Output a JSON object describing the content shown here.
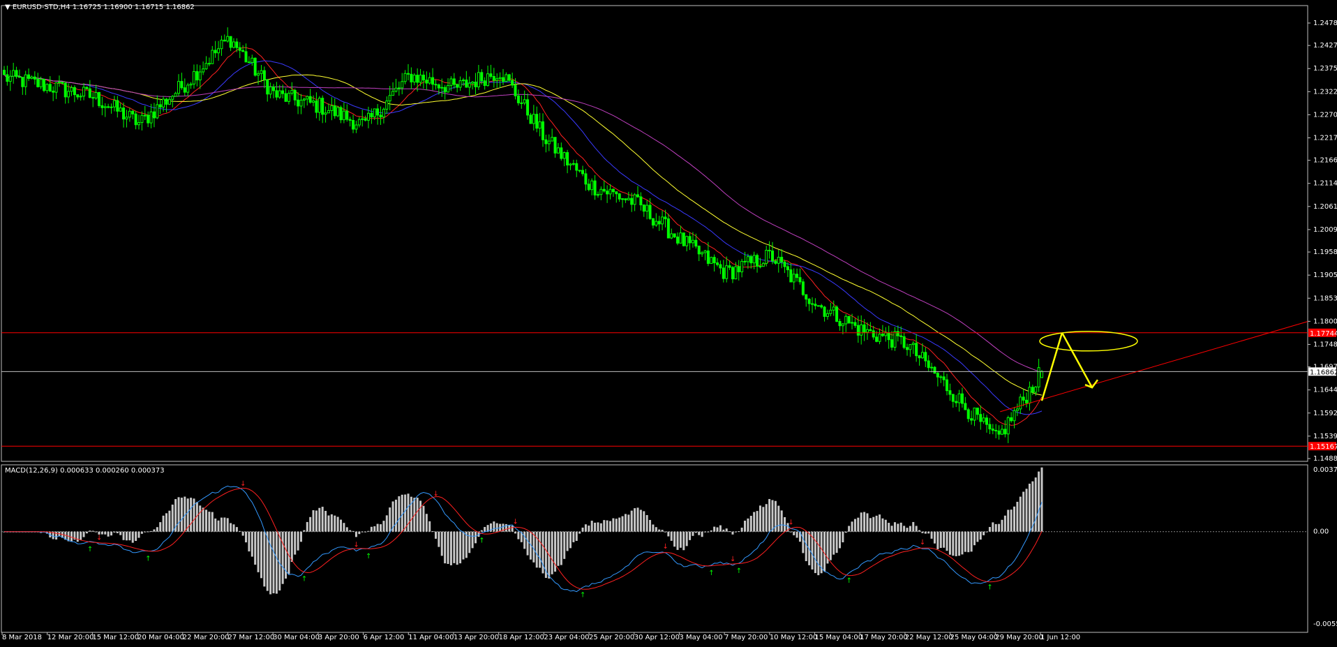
{
  "symbol_info": "EURUSD-STD,H4  1.16725 1.16900 1.16715 1.16862",
  "macd_info": "MACD(12,26,9) 0.000633 0.000260 0.000373",
  "colors": {
    "background": "#000000",
    "frame": "#c0c0c0",
    "candle": "#00ff00",
    "ma_fast": "#ff2020",
    "ma_mid": "#3a3aff",
    "ma_slow": "#ffff30",
    "ma_slowest": "#c040c0",
    "level_line": "#ff0000",
    "price_line": "#c0c0c0",
    "annotation": "#ffff00",
    "histogram": "#c8c8c8",
    "macd_line": "#3399ff",
    "signal_line": "#ff2020",
    "arrow_up": "#00ff00",
    "arrow_down": "#ff2020"
  },
  "price_axis": {
    "labels": [
      "1.24785",
      "1.24275",
      "1.23750",
      "1.23225",
      "1.22700",
      "1.22175",
      "1.21665",
      "1.21140",
      "1.20615",
      "1.20090",
      "1.19580",
      "1.19055",
      "1.18530",
      "1.18005",
      "1.17480",
      "1.16970",
      "1.16445",
      "1.15920",
      "1.15395",
      "1.14885"
    ],
    "resistance_label": "1.17744",
    "current_label": "1.16862",
    "support_label": "1.15167"
  },
  "macd_axis": {
    "top": "0.003788",
    "zero": "0.00",
    "bottom": "-0.005549"
  },
  "time_axis": [
    "8 Mar 2018",
    "12 Mar 20:00",
    "15 Mar 12:00",
    "20 Mar 04:00",
    "22 Mar 20:00",
    "27 Mar 12:00",
    "30 Mar 04:00",
    "3 Apr 20:00",
    "6 Apr 12:00",
    "11 Apr 04:00",
    "13 Apr 20:00",
    "18 Apr 12:00",
    "23 Apr 04:00",
    "25 Apr 20:00",
    "30 Apr 12:00",
    "3 May 04:00",
    "7 May 20:00",
    "10 May 12:00",
    "15 May 04:00",
    "17 May 20:00",
    "22 May 12:00",
    "25 May 04:00",
    "29 May 20:00",
    "1 Jun 12:00"
  ],
  "chart_data": {
    "type": "candlestick",
    "title": "EURUSD-STD,H4",
    "timeframe": "H4",
    "last_bar": {
      "open": 1.16725,
      "high": 1.169,
      "low": 1.16715,
      "close": 1.16862
    },
    "ylim": [
      1.14885,
      1.24785
    ],
    "key_close_path": [
      {
        "t": "8 Mar 2018",
        "price": 1.2355
      },
      {
        "t": "12 Mar 20:00",
        "price": 1.2335
      },
      {
        "t": "15 Mar 12:00",
        "price": 1.231
      },
      {
        "t": "20 Mar 04:00",
        "price": 1.225
      },
      {
        "t": "22 Mar 20:00",
        "price": 1.234
      },
      {
        "t": "27 Mar 12:00",
        "price": 1.2445
      },
      {
        "t": "30 Mar 04:00",
        "price": 1.2315
      },
      {
        "t": "3 Apr 20:00",
        "price": 1.229
      },
      {
        "t": "6 Apr 12:00",
        "price": 1.2245
      },
      {
        "t": "11 Apr 04:00",
        "price": 1.236
      },
      {
        "t": "13 Apr 20:00",
        "price": 1.233
      },
      {
        "t": "18 Apr 12:00",
        "price": 1.237
      },
      {
        "t": "23 Apr 04:00",
        "price": 1.2215
      },
      {
        "t": "25 Apr 20:00",
        "price": 1.211
      },
      {
        "t": "30 Apr 12:00",
        "price": 1.207
      },
      {
        "t": "3 May 04:00",
        "price": 1.1985
      },
      {
        "t": "7 May 20:00",
        "price": 1.191
      },
      {
        "t": "10 May 12:00",
        "price": 1.195
      },
      {
        "t": "15 May 04:00",
        "price": 1.184
      },
      {
        "t": "17 May 20:00",
        "price": 1.178
      },
      {
        "t": "22 May 12:00",
        "price": 1.175
      },
      {
        "t": "25 May 04:00",
        "price": 1.164
      },
      {
        "t": "29 May 20:00",
        "price": 1.153
      },
      {
        "t": "1 Jun 12:00",
        "price": 1.16862
      }
    ],
    "horizontal_levels": [
      1.17744,
      1.16862,
      1.15167
    ],
    "moving_averages": [
      "ma_fast",
      "ma_mid",
      "ma_slow",
      "ma_slowest"
    ],
    "macd": {
      "params": "12,26,9",
      "values": [
        0.000633,
        0.00026,
        0.000373
      ],
      "ylim": [
        -0.005549,
        0.003788
      ]
    },
    "annotations": [
      "uptrend line from 29 May low",
      "yellow projection up to 1.17744 then down",
      "yellow ellipse target at 1.17744"
    ]
  }
}
